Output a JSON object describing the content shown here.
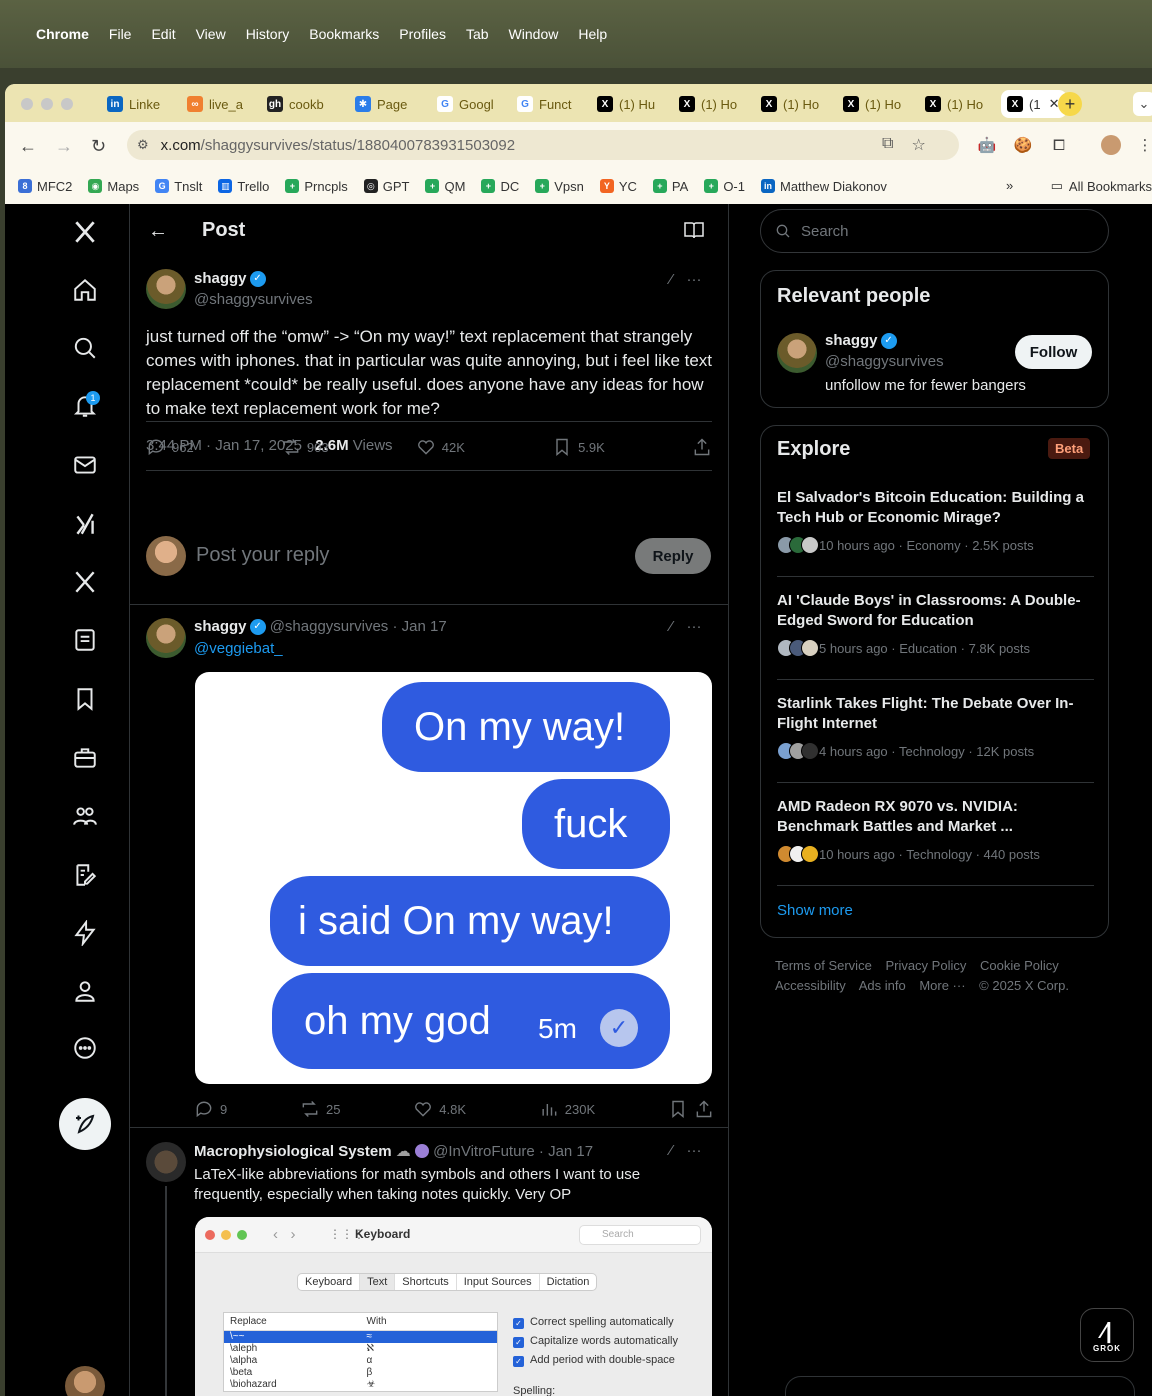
{
  "menubar": {
    "app": "Chrome",
    "items": [
      "File",
      "Edit",
      "View",
      "History",
      "Bookmarks",
      "Profiles",
      "Tab",
      "Window",
      "Help"
    ]
  },
  "tabs": [
    {
      "label": "Linke",
      "color": "#0a66c2",
      "icon": "in"
    },
    {
      "label": "live_a",
      "color": "#f08030",
      "icon": "∞"
    },
    {
      "label": "cookb",
      "color": "#222222",
      "icon": "gh"
    },
    {
      "label": "Page",
      "color": "#2b7de9",
      "icon": "✱"
    },
    {
      "label": "Googl",
      "color": "#ffffff",
      "icon": "G"
    },
    {
      "label": "Funct",
      "color": "#ffffff",
      "icon": "G"
    },
    {
      "label": "(1) Hu",
      "color": "#000000",
      "icon": "X"
    },
    {
      "label": "(1) Ho",
      "color": "#000000",
      "icon": "X"
    },
    {
      "label": "(1) Ho",
      "color": "#000000",
      "icon": "X"
    },
    {
      "label": "(1) Ho",
      "color": "#000000",
      "icon": "X"
    },
    {
      "label": "(1) Ho",
      "color": "#000000",
      "icon": "X"
    },
    {
      "label": "(1",
      "color": "#000000",
      "icon": "X"
    }
  ],
  "omnibox": {
    "host": "x.com",
    "path": "/shaggysurvives/status/1880400783931503092"
  },
  "bookmarks": [
    {
      "label": "MFC2",
      "color": "#3b6fd6",
      "icon": "8"
    },
    {
      "label": "Maps",
      "color": "#34a853",
      "icon": "◉"
    },
    {
      "label": "Tnslt",
      "color": "#4285f4",
      "icon": "G"
    },
    {
      "label": "Trello",
      "color": "#0c66e4",
      "icon": "▥"
    },
    {
      "label": "Prncpls",
      "color": "#27a85a",
      "icon": "+"
    },
    {
      "label": "GPT",
      "color": "#222222",
      "icon": "◎"
    },
    {
      "label": "QM",
      "color": "#27a85a",
      "icon": "+"
    },
    {
      "label": "DC",
      "color": "#27a85a",
      "icon": "+"
    },
    {
      "label": "Vpsn",
      "color": "#27a85a",
      "icon": "+"
    },
    {
      "label": "YC",
      "color": "#f26522",
      "icon": "Y"
    },
    {
      "label": "PA",
      "color": "#27a85a",
      "icon": "+"
    },
    {
      "label": "O-1",
      "color": "#27a85a",
      "icon": "+"
    },
    {
      "label": "Matthew Diakonov",
      "color": "#0a66c2",
      "icon": "in"
    }
  ],
  "bookmarks_more": "»",
  "all_bookmarks": "All Bookmarks",
  "header": {
    "title": "Post"
  },
  "nav": {
    "notification_count": "1"
  },
  "post": {
    "name": "shaggy",
    "handle": "@shaggysurvives",
    "text": "just turned off the “omw” -> “On my way!” text replacement that strangely comes with iphones. that in particular was quite annoying, but i feel like text replacement *could* be really useful. does anyone have any ideas for how to make text replacement work for me?",
    "time": "3:44 PM · Jan 17, 2025 · ",
    "views_count": "2.6M",
    "views_label": " Views",
    "replies": "962",
    "reposts": "903",
    "likes": "42K",
    "bookmarks": "5.9K"
  },
  "reply_box": {
    "placeholder": "Post your reply",
    "button": "Reply"
  },
  "reply1": {
    "name": "shaggy",
    "handle": "@shaggysurvives · Jan 17",
    "mention": "@veggiebat_",
    "bubbles": [
      "On my way!",
      "fuck",
      "i said On my way!",
      "oh my god"
    ],
    "bubble_time": "5m",
    "replies": "9",
    "reposts": "25",
    "likes": "4.8K",
    "views": "230K"
  },
  "reply2": {
    "name": "Macrophysiological System",
    "handle": "@InVitroFuture · Jan 17",
    "text": "LaTeX-like abbreviations for math symbols and others I want to use frequently, especially when taking notes quickly. Very OP",
    "window_title": "Keyboard",
    "search_placeholder": "Search",
    "tabs": [
      "Keyboard",
      "Text",
      "Shortcuts",
      "Input Sources",
      "Dictation"
    ],
    "table_headers": [
      "Replace",
      "With"
    ],
    "rows": [
      [
        "\\~~",
        "≈"
      ],
      [
        "\\aleph",
        "ℵ"
      ],
      [
        "\\alpha",
        "α"
      ],
      [
        "\\beta",
        "β"
      ],
      [
        "\\biohazard",
        "☣"
      ]
    ],
    "options": [
      "Correct spelling automatically",
      "Capitalize words automatically",
      "Add period with double-space"
    ],
    "spelling_label": "Spelling:"
  },
  "search": {
    "placeholder": "Search"
  },
  "relevant": {
    "title": "Relevant people",
    "name": "shaggy",
    "handle": "@shaggysurvives",
    "bio": "unfollow me for fewer bangers",
    "follow": "Follow"
  },
  "explore": {
    "title": "Explore",
    "badge": "Beta",
    "items": [
      {
        "title": "El Salvador's Bitcoin Education: Building a Tech Hub or Economic Mirage?",
        "meta": "10 hours ago · Economy · 2.5K posts"
      },
      {
        "title": "AI 'Claude Boys' in Classrooms: A Double-Edged Sword for Education",
        "meta": "5 hours ago · Education · 7.8K posts"
      },
      {
        "title": "Starlink Takes Flight: The Debate Over In-Flight Internet",
        "meta": "4 hours ago · Technology · 12K posts"
      },
      {
        "title": "AMD Radeon RX 9070 vs. NVIDIA: Benchmark Battles and Market ...",
        "meta": "10 hours ago · Technology · 440 posts"
      }
    ],
    "show_more": "Show more"
  },
  "footer": {
    "links": [
      "Terms of Service",
      "Privacy Policy",
      "Cookie Policy",
      "Accessibility",
      "Ads info",
      "More ···"
    ],
    "copyright": "© 2025 X Corp."
  },
  "grok": {
    "label": "GROK"
  },
  "colors": {
    "accent": "#1d9bf0",
    "background": "#000000",
    "border": "#2f3336",
    "muted": "#71767b",
    "bubble": "#2f5be0"
  }
}
